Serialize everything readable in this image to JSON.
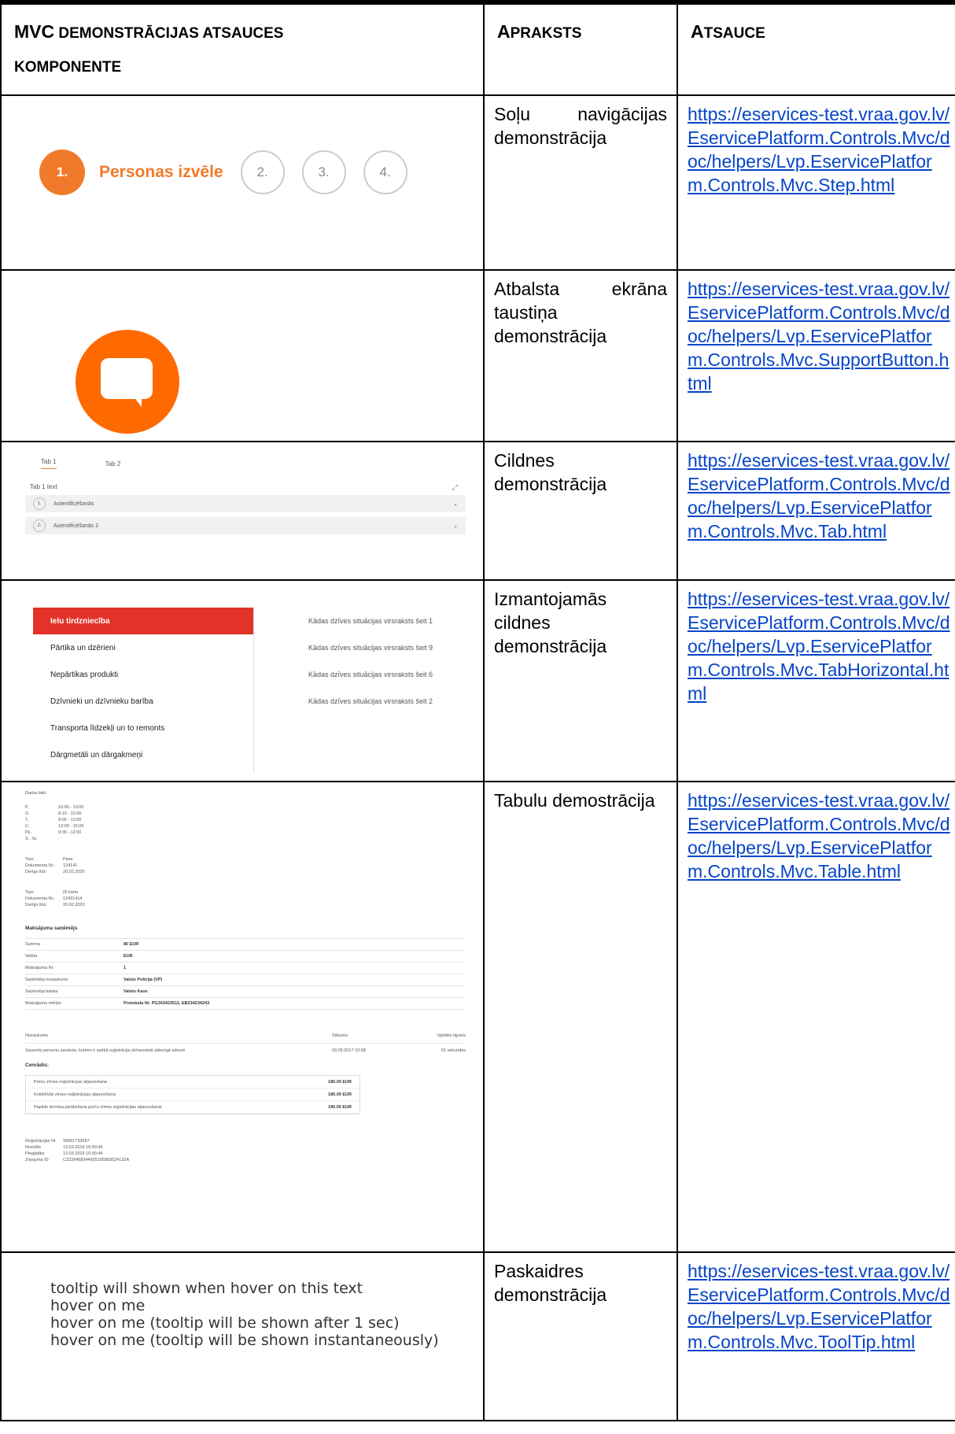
{
  "headers": {
    "col1_big1": "MVC",
    "col1_small1": " DEMONSTRĀCIJAS ATSAUCES",
    "col1_small2": "KOMPONENTE",
    "col2_big": "A",
    "col2_small": "PRAKSTS",
    "col3_big": "A",
    "col3_small": "TSAUCE"
  },
  "rows": [
    {
      "desc": "Soļu navigācijas demonstrācija",
      "link": "https://eservices-test.vraa.gov.lv/EservicePlatform.Controls.Mvc/doc/helpers/Lvp.EservicePlatform.Controls.Mvc.Step.html",
      "demo": {
        "step1": "1.",
        "step1_label": "Personas izvēle",
        "step2": "2.",
        "step3": "3.",
        "step4": "4."
      }
    },
    {
      "desc": "Atbalsta ekrāna taustiņa demonstrācija",
      "link": "https://eservices-test.vraa.gov.lv/EservicePlatform.Controls.Mvc/doc/helpers/Lvp.EservicePlatform.Controls.Mvc.SupportButton.html"
    },
    {
      "desc": "Cildnes demonstrācija",
      "link": "https://eservices-test.vraa.gov.lv/EservicePlatform.Controls.Mvc/doc/helpers/Lvp.EservicePlatform.Controls.Mvc.Tab.html",
      "demo": {
        "tab1": "Tab 1",
        "tab2": "Tab 2",
        "text": "Tab 1 text",
        "acc1_num": "1.",
        "acc1": "Autentificēšanās",
        "acc2_num": "2.",
        "acc2": "Autentificēšanās 2"
      }
    },
    {
      "desc": "Izmantojamās cildnes demonstrācija",
      "link": "https://eservices-test.vraa.gov.lv/EservicePlatform.Controls.Mvc/doc/helpers/Lvp.EservicePlatform.Controls.Mvc.TabHorizontal.html",
      "demo": {
        "left": [
          "Ielu tirdzniecība",
          "Pārtika un dzērieni",
          "Nepārtikas produkti",
          "Dzīvnieki un dzīvnieku barība",
          "Transporta līdzekļi un to remonts",
          "Dārgmetāli un dārgakmeņi"
        ],
        "right": [
          "Kādas dzīves situācijas virsraksts šeit 1",
          "Kādas dzīves situācijas virsraksts šeit 9",
          "Kādas dzīves situācijas virsraksts šeit 6",
          "Kādas dzīves situācijas virsraksts šeit 2"
        ]
      }
    },
    {
      "desc": "Tabulu demostrācija",
      "link": "https://eservices-test.vraa.gov.lv/EservicePlatform.Controls.Mvc/doc/helpers/Lvp.EservicePlatform.Controls.Mvc.Table.html",
      "demo": {
        "work_title": "Darba laiki:",
        "hours": [
          [
            "P.",
            "10:00 - 13:00"
          ],
          [
            "O.",
            "8:10 - 12:00"
          ],
          [
            "T.",
            "9:00 - 13:00"
          ],
          [
            "C.",
            "13:00 - 15:00"
          ],
          [
            "Pk.",
            "9:00 - 12:00"
          ],
          [
            "S., Sv.",
            "-"
          ]
        ],
        "doc1": [
          [
            "Tips:",
            "Pase"
          ],
          [
            "Dokumenta Nr.:",
            "124141"
          ],
          [
            "Derīgs līdz:",
            "20.02.2020"
          ]
        ],
        "doc2": [
          [
            "Tips:",
            "ID karte"
          ],
          [
            "Dokumenta Nr.:",
            "12431414"
          ],
          [
            "Derīgs līdz:",
            "20.02.2020"
          ]
        ],
        "payee_title": "Maksājuma saņēmējs",
        "payee": [
          [
            "Summa",
            "80 EUR"
          ],
          [
            "Valūta",
            "EUR"
          ],
          [
            "Maksājuma Nr.",
            "1"
          ],
          [
            "Saņēmēja nosaukums",
            "Valsts Policija (VP)"
          ],
          [
            "Saņēmēja banka",
            "Valsts Kase"
          ],
          [
            "Maksājuma mērķis",
            "Protokola Nr. PG343423511, EB234234243"
          ]
        ],
        "grid_head": [
          "Nosaukums",
          "Sākums",
          "Izpildes ilgums"
        ],
        "grid_row": [
          "Saņemts personu saraksts, kuriem ir spēkā reģistrācija dzīvesvietā attiecīgā adresē",
          "03.05.2017 10:58",
          "01 sekundes"
        ],
        "fee_title": "Cenrādis:",
        "fees": [
          [
            "Preču zīmes reģistrācijas atjaunošana",
            "180.00 EUR"
          ],
          [
            "Kolektīvās zīmes reģistrācijas atjaunošana",
            "180.00 EUR"
          ],
          [
            "Papildu termiņa piešķiršana preču zīmes reģistrācijas atjaunošanai",
            "180.00 EUR"
          ]
        ],
        "footer": [
          [
            "Reģistrācijas Nr",
            "90001733697"
          ],
          [
            "Nosūtīts",
            "13.03.2019 16:00:44"
          ],
          [
            "Piegādāts",
            "13.03.2019 16:00:44"
          ],
          [
            "Ziņojuma ID",
            "C2228468344925295983524132A"
          ]
        ]
      }
    },
    {
      "desc": "Paskaidres demonstrācija",
      "link": "https://eservices-test.vraa.gov.lv/EservicePlatform.Controls.Mvc/doc/helpers/Lvp.EservicePlatform.Controls.Mvc.ToolTip.html",
      "demo": {
        "lines": [
          "tooltip will shown when hover on this text",
          "hover on me",
          "hover on me (tooltip will be shown after 1 sec)",
          "hover on me (tooltip will be shown instantaneously)"
        ]
      }
    }
  ]
}
